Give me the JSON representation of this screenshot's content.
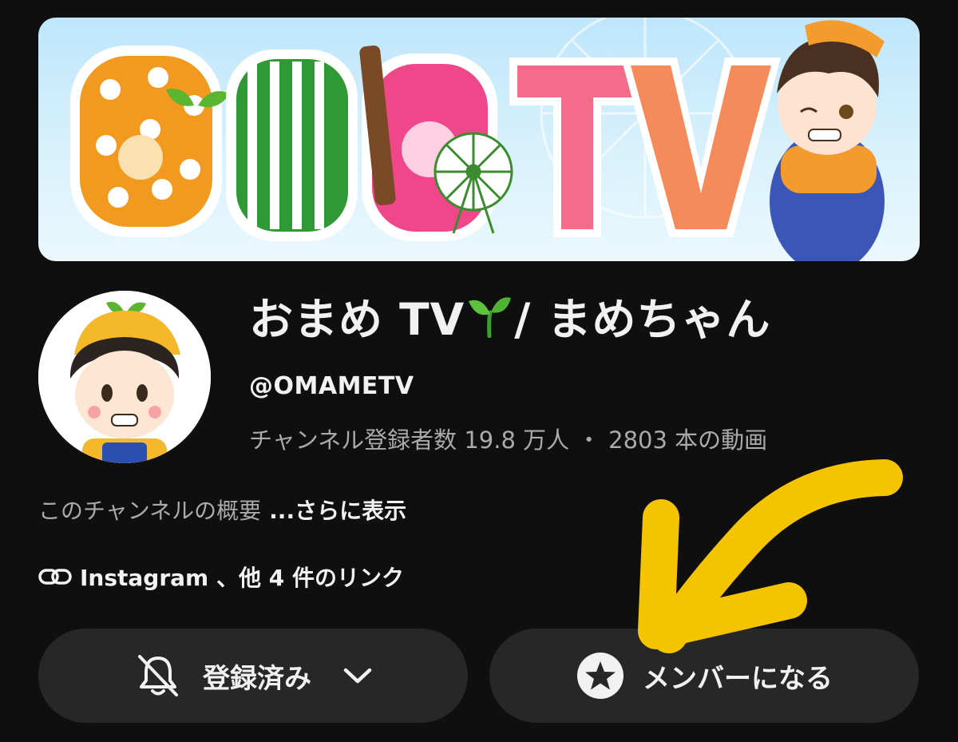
{
  "banner": {
    "title_art": "おまめTV"
  },
  "channel": {
    "name_part1": "おまめ TV",
    "name_part2": "/ まめちゃん",
    "handle": "@OMAMETV",
    "subscribers": "チャンネル登録者数 19.8 万人",
    "separator": "・",
    "videos": "2803 本の動画"
  },
  "description": {
    "text": "このチャンネルの概要",
    "more": "...さらに表示"
  },
  "links": {
    "text": "Instagram 、他 4 件のリンク"
  },
  "buttons": {
    "subscribed_label": "登録済み",
    "member_label": "メンバーになる"
  },
  "icons": {
    "link": "link-icon",
    "bell": "bell-off-icon",
    "chevron": "chevron-down-icon",
    "star": "star-icon",
    "sprout": "sprout-icon"
  },
  "colors": {
    "background": "#0f0f0f",
    "button_bg": "#272727",
    "text_primary": "#f1f1f1",
    "text_secondary": "#aaaaaa",
    "annotation_arrow": "#f5c400"
  }
}
